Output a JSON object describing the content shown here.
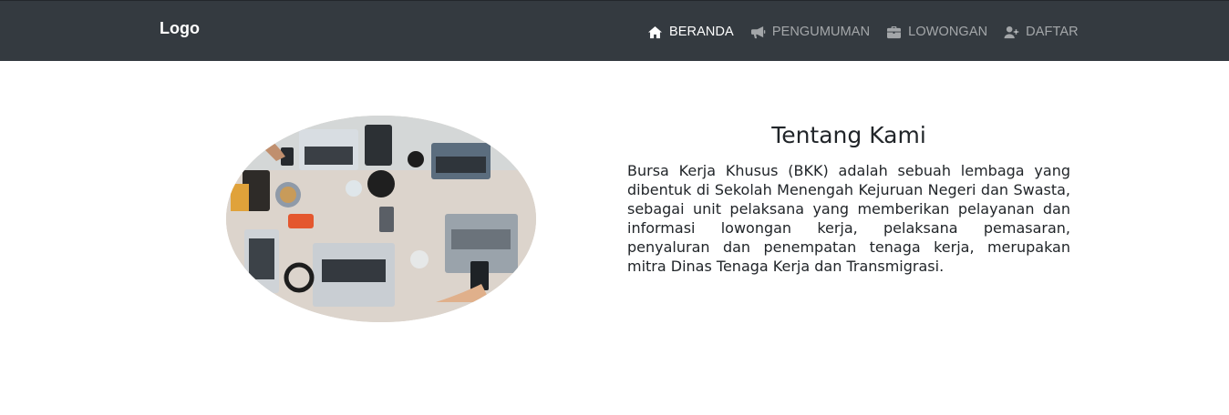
{
  "navbar": {
    "brand": "Logo",
    "items": [
      {
        "label": "BERANDA",
        "icon": "home-icon",
        "active": true
      },
      {
        "label": "PENGUMUMAN",
        "icon": "megaphone-icon",
        "active": false
      },
      {
        "label": "LOWONGAN",
        "icon": "briefcase-icon",
        "active": false
      },
      {
        "label": "DAFTAR",
        "icon": "user-plus-icon",
        "active": false
      }
    ],
    "background": "#343a40"
  },
  "about": {
    "title": "Tentang Kami",
    "body": "Bursa Kerja Khusus (BKK) adalah sebuah lembaga yang dibentuk di Sekolah Menengah Kejuruan Negeri dan Swasta, sebagai unit pelaksana yang memberikan pelayanan dan informasi lowongan kerja, pelaksana pemasaran, penyaluran dan penempatan tenaga kerja, merupakan mitra Dinas Tenaga Kerja dan Transmigrasi."
  }
}
